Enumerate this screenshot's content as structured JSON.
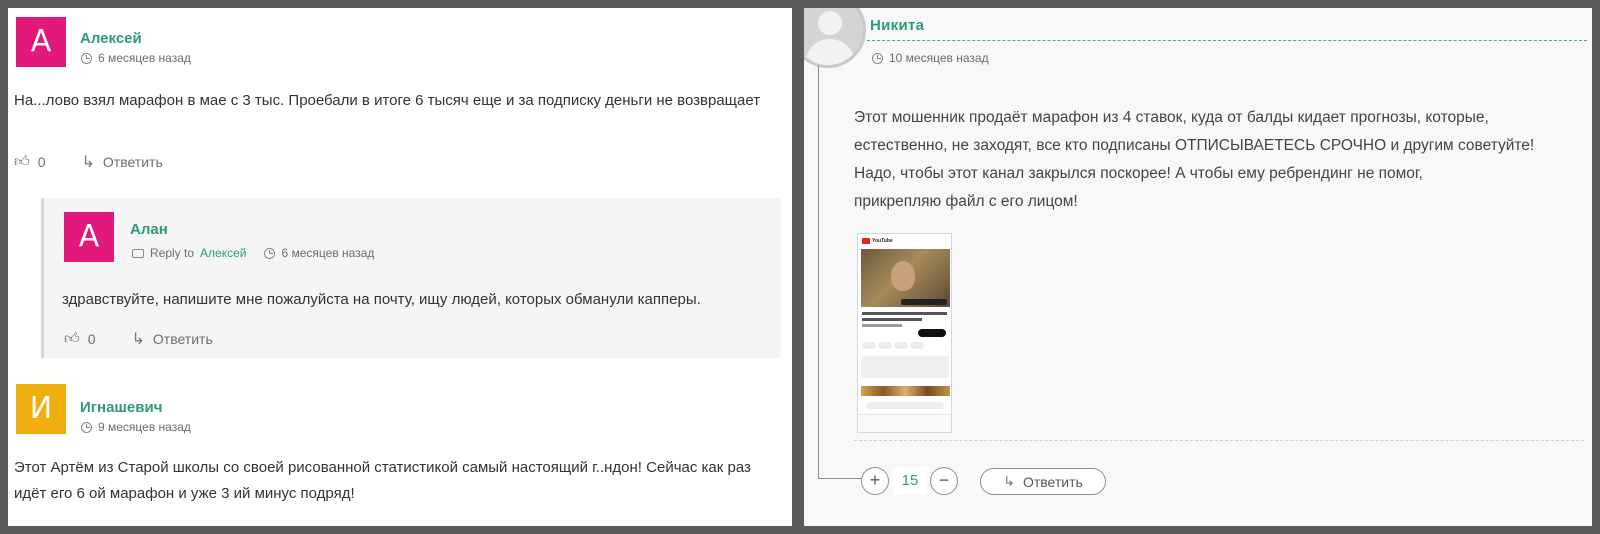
{
  "left": {
    "comments": [
      {
        "avatar_letter": "А",
        "avatar_color": "#e0197a",
        "author": "Алексей",
        "time": "6 месяцев назад",
        "text": "На...лово взял марафон в мае с 3 тыс. Проебали в итоге 6 тысяч еще и за подписку деньги не возвращает",
        "likes": "0",
        "reply_label": "Ответить"
      },
      {
        "avatar_letter": "И",
        "avatar_color": "#f0ad0e",
        "author": "Игнашевич",
        "time": "9 месяцев назад",
        "text": "Этот Артём из Старой школы со своей рисованной статистикой самый настоящий г..ндон! Сейчас как раз идёт его 6 ой марафон и уже 3 ий минус подряд!"
      }
    ],
    "reply": {
      "avatar_letter": "А",
      "avatar_color": "#e0197a",
      "author": "Алан",
      "reply_to_prefix": "Reply to",
      "reply_to_name": "Алексей",
      "time": "6 месяцев назад",
      "text": "здравствуйте, напишите мне пожалуйста на почту, ищу людей, которых обманули капперы.",
      "likes": "0",
      "reply_label": "Ответить"
    }
  },
  "right": {
    "author": "Никита",
    "time": "10 месяцев назад",
    "paragraphs": [
      "Этот мошенник продаёт марафон из 4 ставок, куда от балды кидает прогнозы, которые,",
      "естественно, не заходят, все кто подписаны ОТПИСЫВАЕТЕСЬ СРОЧНО и другим советуйте!",
      "Надо, чтобы этот канал закрылся поскорее! А чтобы ему ребрендинг не помог,",
      "прикрепляю файл с его лицом!"
    ],
    "attachment_app": "YouTube",
    "vote_plus": "+",
    "vote_count": "15",
    "vote_minus": "−",
    "reply_label": "Ответить"
  },
  "colors": {
    "author_green": "#2e9b76",
    "pink_avatar": "#e0197a",
    "yellow_avatar": "#f0ad0e",
    "page_bg": "#5a5a5a"
  },
  "icons": [
    "clock-icon",
    "thumbs-up-icon",
    "reply-arrow-icon",
    "chat-bubble-icon",
    "default-avatar-icon"
  ]
}
